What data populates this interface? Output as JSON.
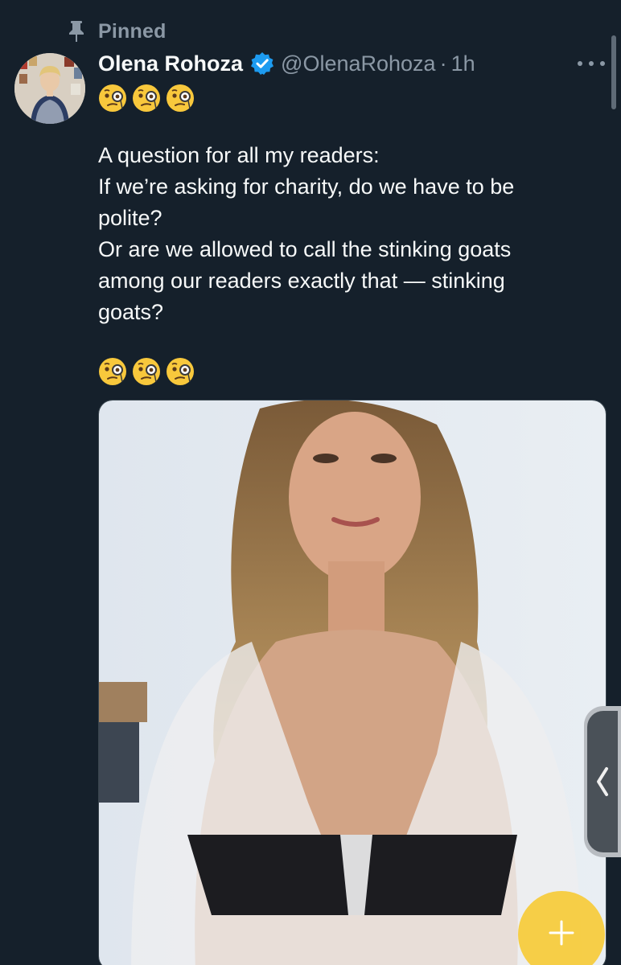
{
  "pinned": {
    "label": "Pinned",
    "icon": "pin-icon"
  },
  "author": {
    "display_name": "Olena Rohoza",
    "verified_icon": "verified-badge-icon",
    "handle": "@OlenaRohoza",
    "separator": "·",
    "time": "1h",
    "avatar_icon": "avatar"
  },
  "tweet": {
    "emoji_top": [
      "face-with-monocle",
      "face-with-monocle",
      "face-with-monocle"
    ],
    "lines": [
      "A question for all my readers:",
      "If we’re asking for charity, do we have to be",
      "polite?",
      "Or are we allowed to call the stinking goats",
      "among our readers exactly that — stinking",
      "goats?"
    ],
    "emoji_bottom": [
      "face-with-monocle",
      "face-with-monocle",
      "face-with-monocle"
    ]
  },
  "controls": {
    "more_icon": "more-horizontal-icon",
    "side_tab_icon": "chevron-left-icon",
    "compose_icon": "plus-icon"
  },
  "colors": {
    "background": "#15202b",
    "text_primary": "#f7f9f9",
    "text_secondary": "#8b98a5",
    "verified_blue": "#1d9bf0",
    "fab": "#f6cb3a"
  }
}
